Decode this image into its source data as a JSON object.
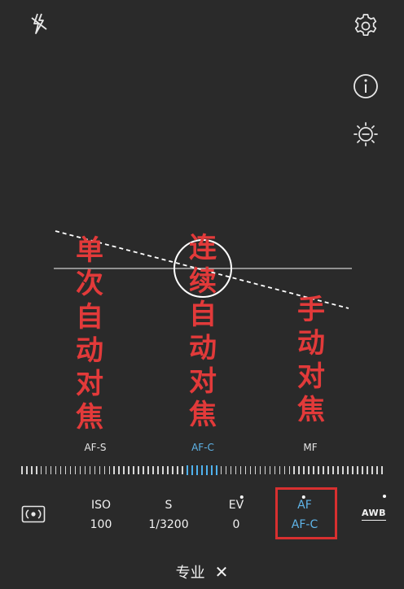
{
  "top_icons": {
    "flash": "flash-off-icon",
    "settings": "gear-icon",
    "info": "info-icon",
    "exposure": "brightness-icon"
  },
  "annotations": {
    "single_af": [
      "单",
      "次",
      "自",
      "动",
      "对",
      "焦"
    ],
    "continuous_af": [
      "连",
      "续",
      "自",
      "动",
      "对",
      "焦"
    ],
    "manual_focus": [
      "手",
      "动",
      "对",
      "焦"
    ]
  },
  "focus_modes": [
    {
      "label": "AF-S",
      "active": false
    },
    {
      "label": "AF-C",
      "active": true
    },
    {
      "label": "MF",
      "active": false
    }
  ],
  "controls": {
    "metering_icon": "metering-icon",
    "iso": {
      "label": "ISO",
      "value": "100"
    },
    "shutter": {
      "label": "S",
      "value": "1/3200"
    },
    "ev": {
      "label": "EV",
      "value": "0"
    },
    "af": {
      "label": "AF",
      "value": "AF-C"
    },
    "awb": {
      "label": "AWB"
    }
  },
  "footer": {
    "mode": "专业",
    "close": "✕"
  },
  "colors": {
    "background": "#2a2a2a",
    "accent": "#5fb4e8",
    "annotation": "#e23a3a"
  }
}
